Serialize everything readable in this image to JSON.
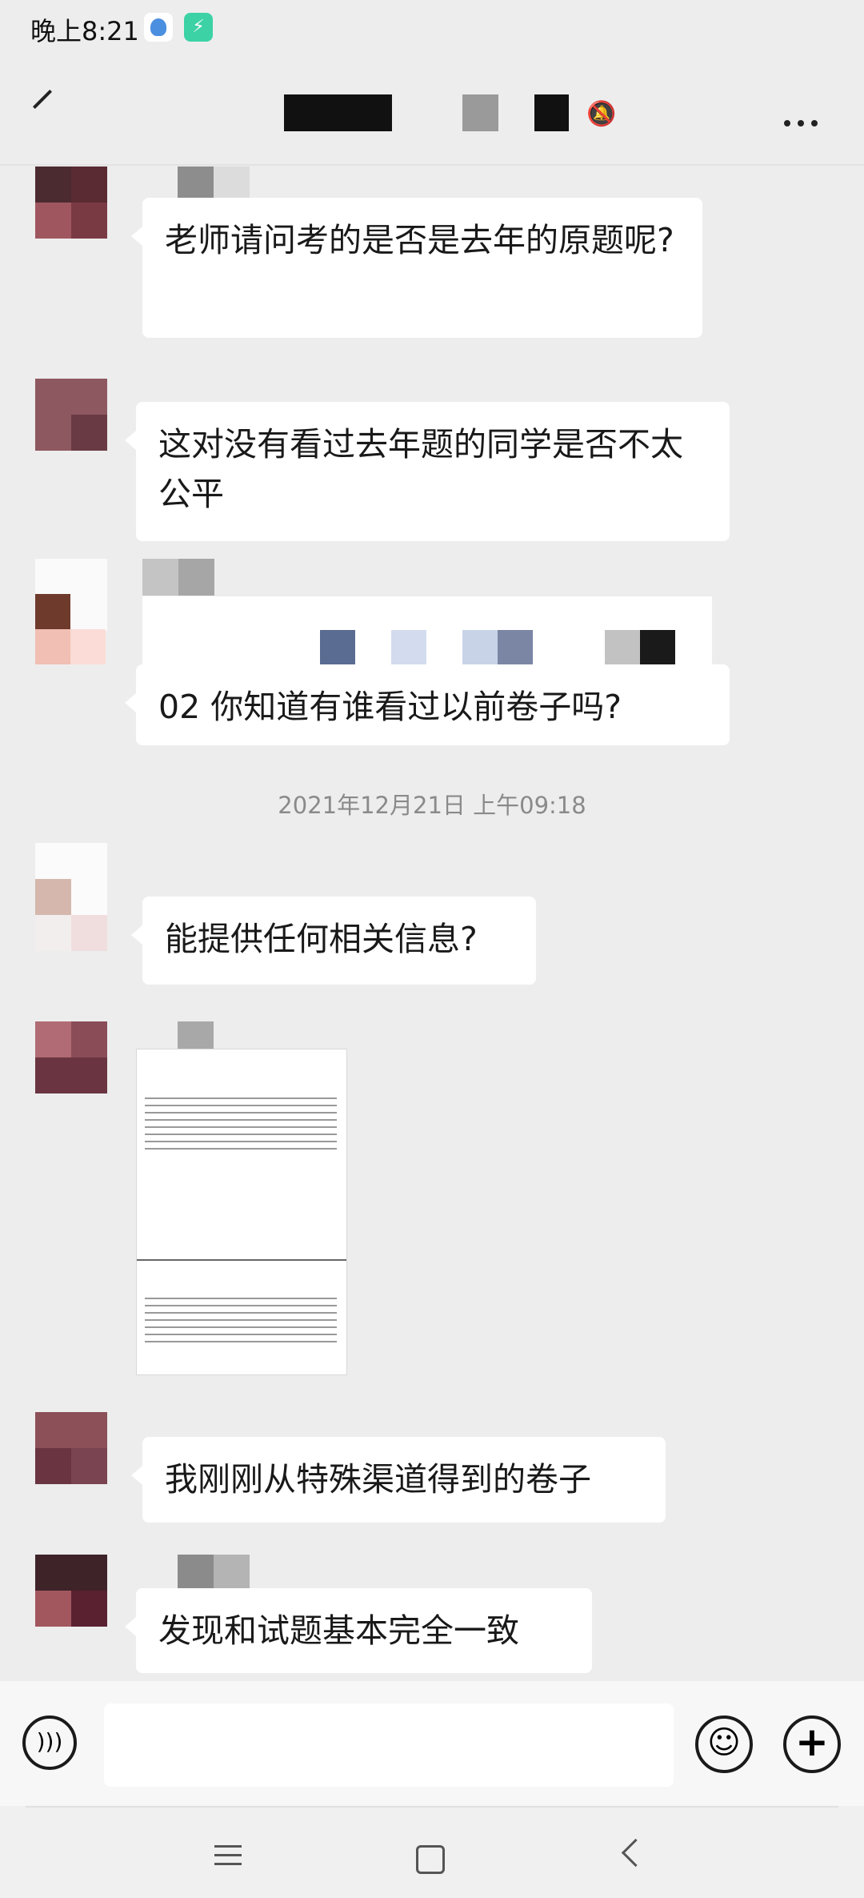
{
  "status_bar": {
    "time": "晚上8:21"
  },
  "header": {
    "menu_icon": "more-dots-icon",
    "mute_icon": "bell-muted-icon"
  },
  "messages": [
    {
      "text": "老师请问考的是否是去年的原题呢?"
    },
    {
      "text": "这对没有看过去年题的同学是否不太公平"
    },
    {
      "text": "02 你知道有谁看过以前卷子吗?"
    },
    {
      "text": "能提供任何相关信息?"
    },
    {
      "text": "我刚刚从特殊渠道得到的卷子"
    },
    {
      "text": "发现和试题基本完全一致"
    }
  ],
  "time_separator": "2021年12月21日 上午09:18",
  "bottom_bar": {
    "voice_icon": "voice-icon",
    "emoji_icon": "emoji-icon",
    "plus_icon": "plus-icon"
  },
  "colors": {
    "background": "#ededed",
    "bubble": "#ffffff"
  }
}
